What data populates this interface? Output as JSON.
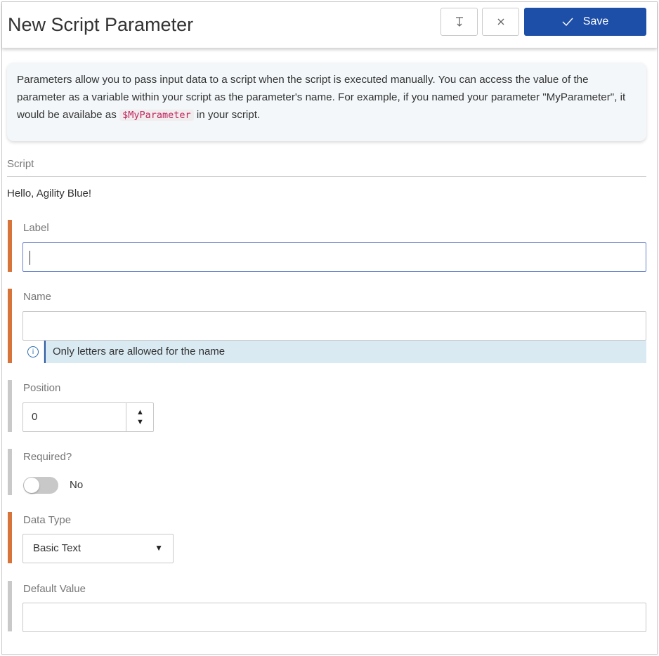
{
  "header": {
    "title": "New Script Parameter",
    "collapse_icon": "collapse-down-icon",
    "close_icon": "close-icon",
    "save_label": "Save"
  },
  "info": {
    "text_before": "Parameters allow you to pass input data to a script when the script is executed manually. You can access the value of the parameter as a variable within your script as the parameter's name. For example, if you named your parameter \"MyParameter\", it would be availabe as ",
    "code": "$MyParameter",
    "text_after": " in your script."
  },
  "script": {
    "label": "Script",
    "value": "Hello, Agility Blue!"
  },
  "fields": {
    "label": {
      "label": "Label",
      "value": ""
    },
    "name": {
      "label": "Name",
      "value": "",
      "hint": "Only letters are allowed for the name"
    },
    "position": {
      "label": "Position",
      "value": "0"
    },
    "required": {
      "label": "Required?",
      "state": "No",
      "checked": false
    },
    "data_type": {
      "label": "Data Type",
      "selected": "Basic Text"
    },
    "default_value": {
      "label": "Default Value",
      "value": ""
    }
  },
  "colors": {
    "required_bar": "#d6743a",
    "optional_bar": "#c9c9c9",
    "save_button": "#1e4fa8",
    "hint_background": "#d9eaf2"
  }
}
